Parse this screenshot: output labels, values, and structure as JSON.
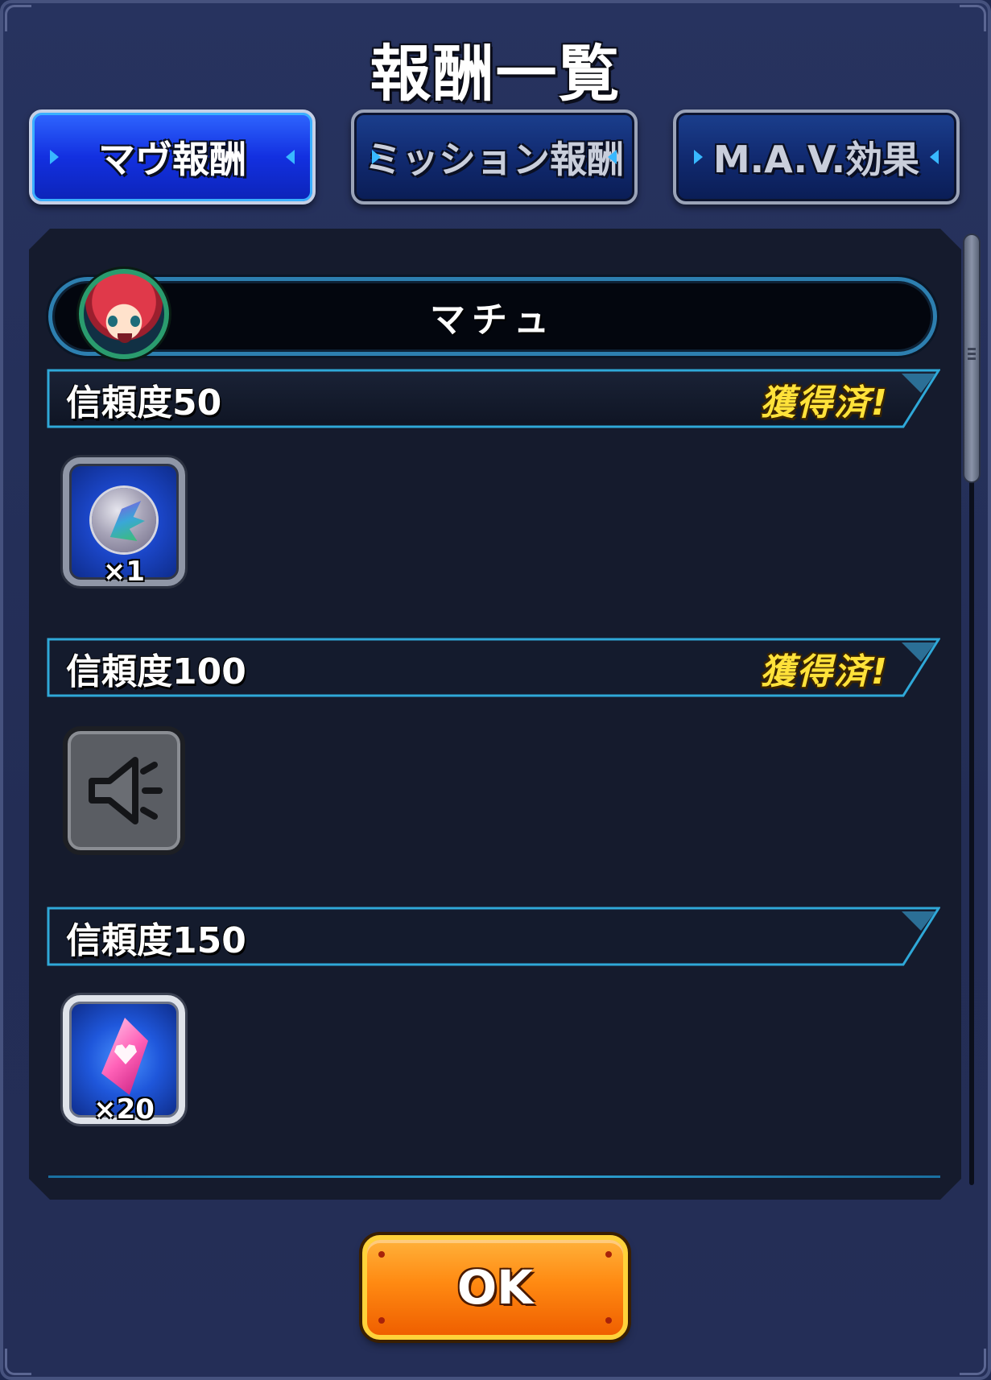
{
  "dialog": {
    "title": "報酬一覧"
  },
  "tabs": [
    {
      "label": "マヴ報酬",
      "active": true
    },
    {
      "label": "ミッション報酬",
      "active": false
    },
    {
      "label": "M.A.V.効果",
      "active": false
    }
  ],
  "character": {
    "name": "マチュ"
  },
  "tiers": [
    {
      "label": "信頼度50",
      "status": "獲得済!",
      "reward": {
        "icon": "orb-item-icon",
        "quantity": "×1"
      }
    },
    {
      "label": "信頼度100",
      "status": "獲得済!",
      "reward": {
        "icon": "voice-speaker-icon",
        "quantity": ""
      }
    },
    {
      "label": "信頼度150",
      "status": "",
      "reward": {
        "icon": "heart-gem-icon",
        "quantity": "×20"
      }
    }
  ],
  "ok_button": {
    "label": "OK"
  },
  "colors": {
    "accent_yellow": "#ffe23a",
    "ok_orange": "#ff8a12",
    "tab_active": "#1330e0",
    "border_cyan": "#2fa8d8"
  }
}
